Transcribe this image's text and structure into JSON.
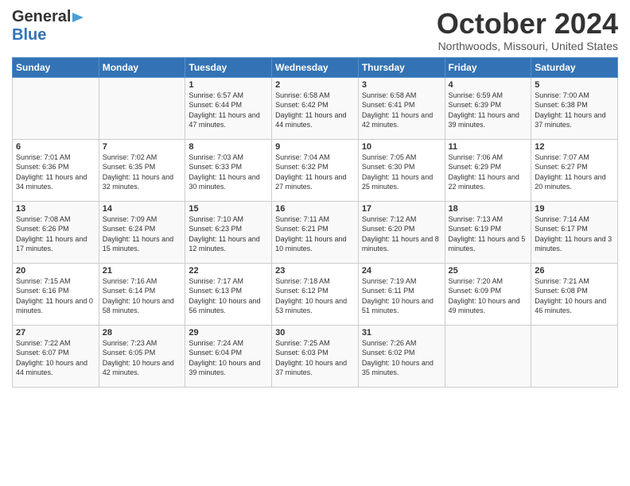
{
  "header": {
    "logo_line1": "General",
    "logo_line2": "Blue",
    "month": "October 2024",
    "location": "Northwoods, Missouri, United States"
  },
  "days_of_week": [
    "Sunday",
    "Monday",
    "Tuesday",
    "Wednesday",
    "Thursday",
    "Friday",
    "Saturday"
  ],
  "weeks": [
    [
      {
        "day": "",
        "info": ""
      },
      {
        "day": "",
        "info": ""
      },
      {
        "day": "1",
        "info": "Sunrise: 6:57 AM\nSunset: 6:44 PM\nDaylight: 11 hours and 47 minutes."
      },
      {
        "day": "2",
        "info": "Sunrise: 6:58 AM\nSunset: 6:42 PM\nDaylight: 11 hours and 44 minutes."
      },
      {
        "day": "3",
        "info": "Sunrise: 6:58 AM\nSunset: 6:41 PM\nDaylight: 11 hours and 42 minutes."
      },
      {
        "day": "4",
        "info": "Sunrise: 6:59 AM\nSunset: 6:39 PM\nDaylight: 11 hours and 39 minutes."
      },
      {
        "day": "5",
        "info": "Sunrise: 7:00 AM\nSunset: 6:38 PM\nDaylight: 11 hours and 37 minutes."
      }
    ],
    [
      {
        "day": "6",
        "info": "Sunrise: 7:01 AM\nSunset: 6:36 PM\nDaylight: 11 hours and 34 minutes."
      },
      {
        "day": "7",
        "info": "Sunrise: 7:02 AM\nSunset: 6:35 PM\nDaylight: 11 hours and 32 minutes."
      },
      {
        "day": "8",
        "info": "Sunrise: 7:03 AM\nSunset: 6:33 PM\nDaylight: 11 hours and 30 minutes."
      },
      {
        "day": "9",
        "info": "Sunrise: 7:04 AM\nSunset: 6:32 PM\nDaylight: 11 hours and 27 minutes."
      },
      {
        "day": "10",
        "info": "Sunrise: 7:05 AM\nSunset: 6:30 PM\nDaylight: 11 hours and 25 minutes."
      },
      {
        "day": "11",
        "info": "Sunrise: 7:06 AM\nSunset: 6:29 PM\nDaylight: 11 hours and 22 minutes."
      },
      {
        "day": "12",
        "info": "Sunrise: 7:07 AM\nSunset: 6:27 PM\nDaylight: 11 hours and 20 minutes."
      }
    ],
    [
      {
        "day": "13",
        "info": "Sunrise: 7:08 AM\nSunset: 6:26 PM\nDaylight: 11 hours and 17 minutes."
      },
      {
        "day": "14",
        "info": "Sunrise: 7:09 AM\nSunset: 6:24 PM\nDaylight: 11 hours and 15 minutes."
      },
      {
        "day": "15",
        "info": "Sunrise: 7:10 AM\nSunset: 6:23 PM\nDaylight: 11 hours and 12 minutes."
      },
      {
        "day": "16",
        "info": "Sunrise: 7:11 AM\nSunset: 6:21 PM\nDaylight: 11 hours and 10 minutes."
      },
      {
        "day": "17",
        "info": "Sunrise: 7:12 AM\nSunset: 6:20 PM\nDaylight: 11 hours and 8 minutes."
      },
      {
        "day": "18",
        "info": "Sunrise: 7:13 AM\nSunset: 6:19 PM\nDaylight: 11 hours and 5 minutes."
      },
      {
        "day": "19",
        "info": "Sunrise: 7:14 AM\nSunset: 6:17 PM\nDaylight: 11 hours and 3 minutes."
      }
    ],
    [
      {
        "day": "20",
        "info": "Sunrise: 7:15 AM\nSunset: 6:16 PM\nDaylight: 11 hours and 0 minutes."
      },
      {
        "day": "21",
        "info": "Sunrise: 7:16 AM\nSunset: 6:14 PM\nDaylight: 10 hours and 58 minutes."
      },
      {
        "day": "22",
        "info": "Sunrise: 7:17 AM\nSunset: 6:13 PM\nDaylight: 10 hours and 56 minutes."
      },
      {
        "day": "23",
        "info": "Sunrise: 7:18 AM\nSunset: 6:12 PM\nDaylight: 10 hours and 53 minutes."
      },
      {
        "day": "24",
        "info": "Sunrise: 7:19 AM\nSunset: 6:11 PM\nDaylight: 10 hours and 51 minutes."
      },
      {
        "day": "25",
        "info": "Sunrise: 7:20 AM\nSunset: 6:09 PM\nDaylight: 10 hours and 49 minutes."
      },
      {
        "day": "26",
        "info": "Sunrise: 7:21 AM\nSunset: 6:08 PM\nDaylight: 10 hours and 46 minutes."
      }
    ],
    [
      {
        "day": "27",
        "info": "Sunrise: 7:22 AM\nSunset: 6:07 PM\nDaylight: 10 hours and 44 minutes."
      },
      {
        "day": "28",
        "info": "Sunrise: 7:23 AM\nSunset: 6:05 PM\nDaylight: 10 hours and 42 minutes."
      },
      {
        "day": "29",
        "info": "Sunrise: 7:24 AM\nSunset: 6:04 PM\nDaylight: 10 hours and 39 minutes."
      },
      {
        "day": "30",
        "info": "Sunrise: 7:25 AM\nSunset: 6:03 PM\nDaylight: 10 hours and 37 minutes."
      },
      {
        "day": "31",
        "info": "Sunrise: 7:26 AM\nSunset: 6:02 PM\nDaylight: 10 hours and 35 minutes."
      },
      {
        "day": "",
        "info": ""
      },
      {
        "day": "",
        "info": ""
      }
    ]
  ]
}
